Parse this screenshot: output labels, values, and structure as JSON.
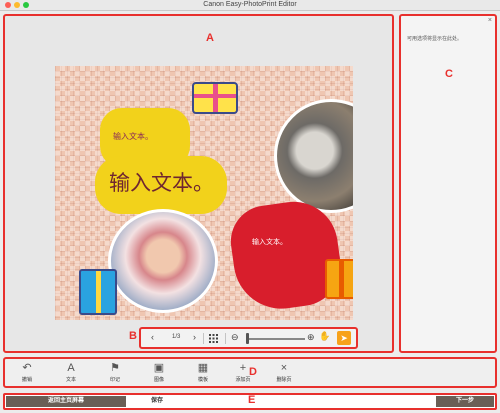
{
  "window": {
    "title": "Canon Easy-PhotoPrint Editor"
  },
  "labels": {
    "a": "A",
    "b": "B",
    "c": "C",
    "d": "D",
    "e": "E"
  },
  "canvas": {
    "text_small": "输入文本。",
    "text_big": "输入文本。",
    "text_red": "输入文本。"
  },
  "navbar": {
    "prev": "‹",
    "page": "1/3",
    "next": "›",
    "grid_icon": "grid-icon",
    "zoom_out": "⊖",
    "zoom_in": "⊕",
    "hand": "✋",
    "pointer": "➤"
  },
  "options_panel": {
    "hint": "可用选项将显示在此处。",
    "close": "×"
  },
  "toolbar": {
    "items": [
      {
        "label": "撤销",
        "icon": "↶"
      },
      {
        "label": "文本",
        "icon": "A"
      },
      {
        "label": "印记",
        "icon": "⚑"
      },
      {
        "label": "图像",
        "icon": "▣"
      },
      {
        "label": "模板",
        "icon": "▦"
      },
      {
        "label": "添加页",
        "icon": "+"
      },
      {
        "label": "删除页",
        "icon": "×"
      }
    ]
  },
  "bottom": {
    "home": "返回主页屏幕",
    "save": "保存",
    "next": "下一步"
  },
  "colors": {
    "accent": "#e8302d",
    "dark_button": "#6a5f56",
    "pointer": "#f7a21b"
  }
}
